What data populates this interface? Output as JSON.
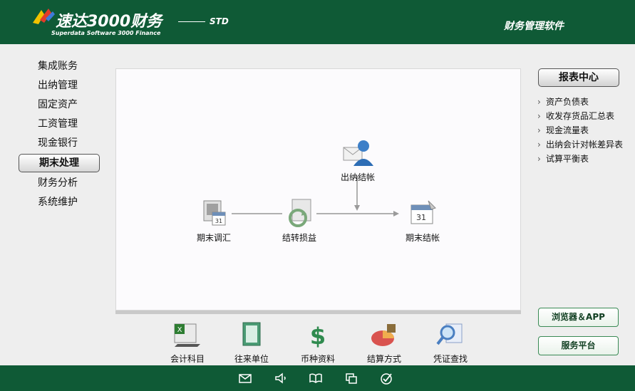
{
  "header": {
    "brand_title": "速达3000财务",
    "brand_subtitle": "Superdata Software 3000 Finance",
    "edition": "STD",
    "right_title": "财务管理软件"
  },
  "sidebar": {
    "items": [
      {
        "label": "集成账务"
      },
      {
        "label": "出纳管理"
      },
      {
        "label": "固定资产"
      },
      {
        "label": "工资管理"
      },
      {
        "label": "现金银行"
      },
      {
        "label": "期末处理",
        "active": true
      },
      {
        "label": "财务分析"
      },
      {
        "label": "系统维护"
      }
    ]
  },
  "flow": {
    "nodes": [
      {
        "label": "出纳结帐",
        "icon": "user-mail-icon"
      },
      {
        "label": "期末调汇",
        "icon": "calendar-doc-icon"
      },
      {
        "label": "结转损益",
        "icon": "recycle-icon"
      },
      {
        "label": "期末结帐",
        "icon": "calendar-icon"
      }
    ]
  },
  "tools": {
    "items": [
      {
        "label": "会计科目",
        "icon": "spreadsheet-icon"
      },
      {
        "label": "往来单位",
        "icon": "folder-book-icon"
      },
      {
        "label": "币种资料",
        "icon": "dollar-icon"
      },
      {
        "label": "结算方式",
        "icon": "pie-chart-icon"
      },
      {
        "label": "凭证查找",
        "icon": "magnifier-doc-icon"
      }
    ]
  },
  "reports": {
    "title": "报表中心",
    "items": [
      {
        "label": "资产负债表"
      },
      {
        "label": "收发存货品汇总表"
      },
      {
        "label": "现金流量表"
      },
      {
        "label": "出纳会计对帐差异表"
      },
      {
        "label": "试算平衡表"
      }
    ]
  },
  "buttons": {
    "browser_app": "浏览器＆APP",
    "service_platform": "服务平台"
  },
  "footer": {
    "icons": [
      "mail-icon",
      "speaker-icon",
      "book-icon",
      "windows-icon",
      "check-circle-icon"
    ]
  },
  "colors": {
    "brand_green": "#0f5a36",
    "panel_gray": "#eeeeee"
  }
}
